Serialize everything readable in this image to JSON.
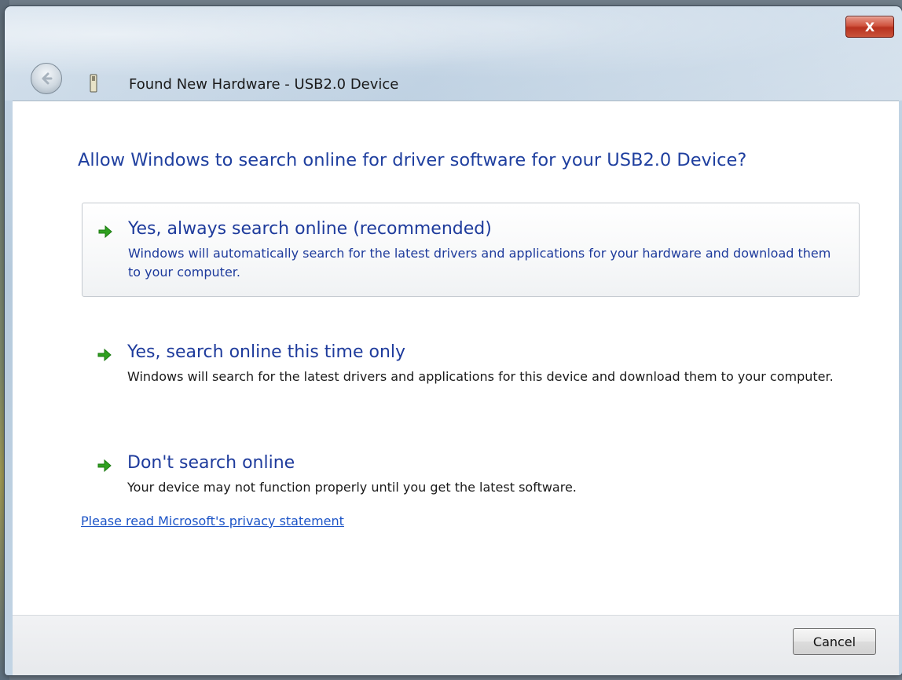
{
  "window": {
    "title": "Found New Hardware - USB2.0 Device",
    "close_label": "X"
  },
  "main": {
    "heading": "Allow Windows to search online for driver software for your USB2.0 Device?",
    "options": [
      {
        "title": "Yes, always search online (recommended)",
        "description": "Windows will automatically search for the latest drivers and applications for your hardware and download them to your computer."
      },
      {
        "title": "Yes, search online this time only",
        "description": "Windows will search for the latest drivers and applications for this device and download them to your computer."
      },
      {
        "title": "Don't search online",
        "description": "Your device may not function properly until you get the latest software."
      }
    ],
    "privacy_link": "Please read Microsoft's  privacy statement"
  },
  "footer": {
    "cancel_label": "Cancel"
  },
  "icons": {
    "back": "back-arrow-icon",
    "device": "usb-device-icon",
    "option_arrow": "green-arrow-icon"
  },
  "colors": {
    "link_blue": "#1e3b9c",
    "arrow_green": "#2fa11f"
  }
}
